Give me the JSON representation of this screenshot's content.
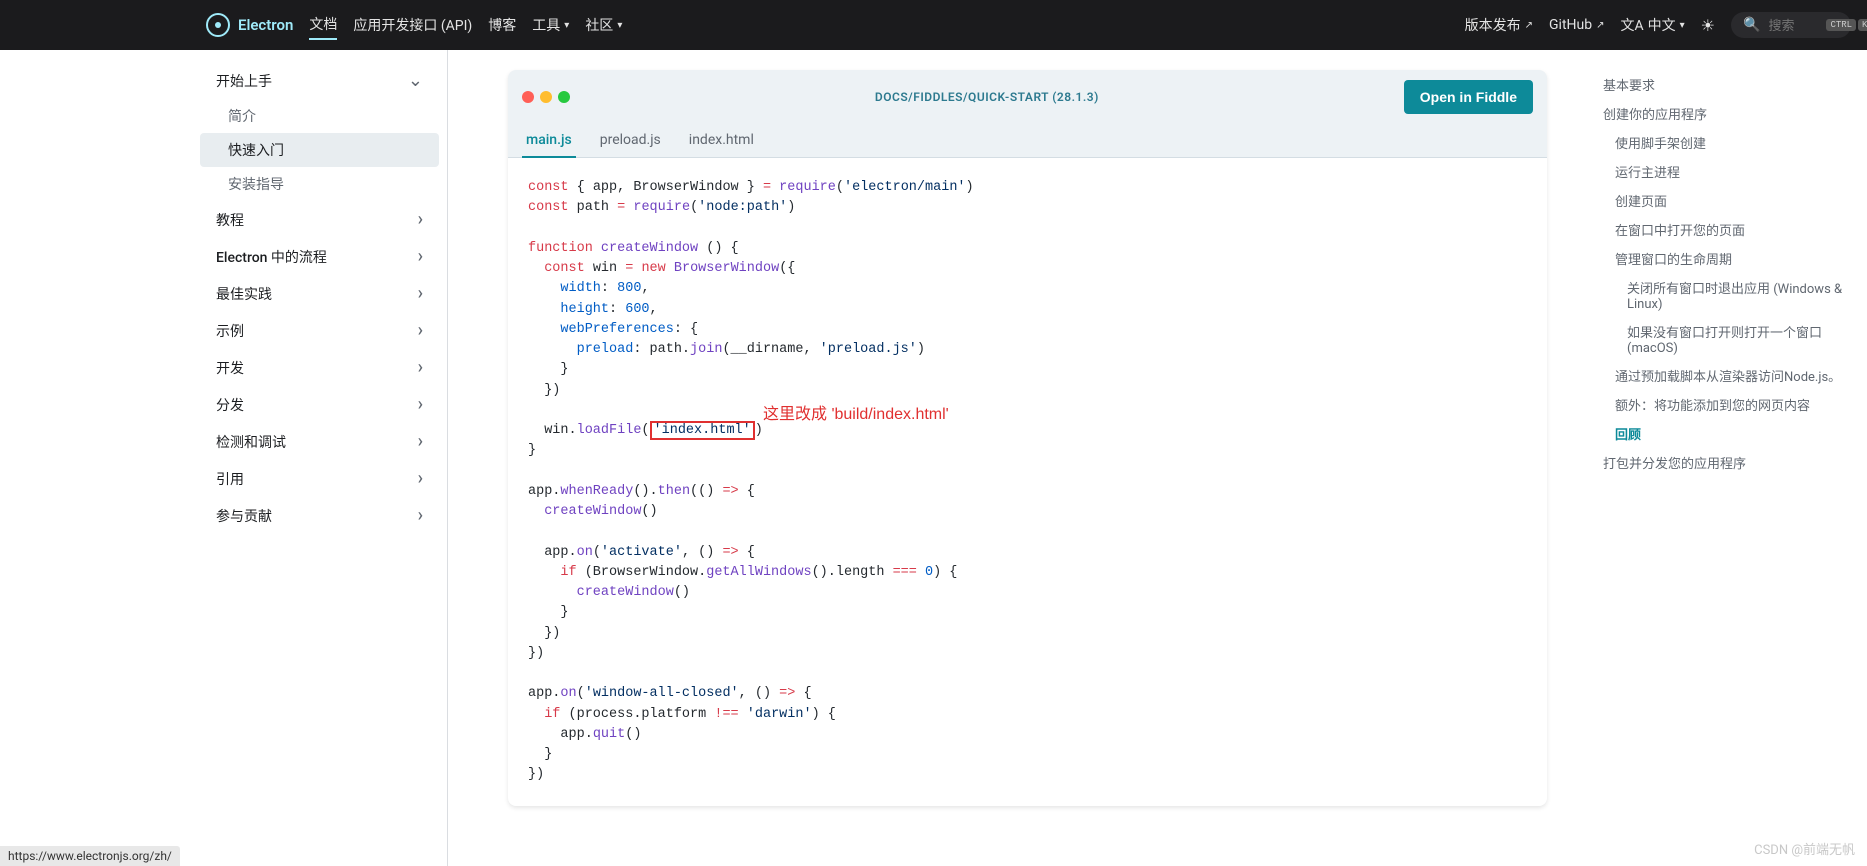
{
  "nav": {
    "brand": "Electron",
    "links": [
      "文档",
      "应用开发接口 (API)",
      "博客",
      "工具",
      "社区"
    ],
    "right_links": [
      "版本发布",
      "GitHub",
      "中文"
    ],
    "lang_prefix": "文A",
    "search_placeholder": "搜索",
    "kbd_keys": [
      "CTRL",
      "K"
    ]
  },
  "sidebar": {
    "categories": [
      {
        "label": "开始上手",
        "expanded": true,
        "items": [
          "简介",
          "快速入门",
          "安装指导"
        ],
        "active": 1
      },
      {
        "label": "教程"
      },
      {
        "label": "Electron 中的流程"
      },
      {
        "label": "最佳实践"
      },
      {
        "label": "示例"
      },
      {
        "label": "开发"
      },
      {
        "label": "分发"
      },
      {
        "label": "检测和调试"
      },
      {
        "label": "引用"
      },
      {
        "label": "参与贡献"
      }
    ]
  },
  "fiddle": {
    "title": "DOCS/FIDDLES/QUICK-START (28.1.3)",
    "open_button": "Open in Fiddle",
    "tabs": [
      "main.js",
      "preload.js",
      "index.html"
    ],
    "active_tab": 0,
    "highlight_text": "'index.html'",
    "annotation": "这里改成 'build/index.html'",
    "code_lines": [
      {
        "t": "const { app, BrowserWindow } = require('electron/main')"
      },
      {
        "t": "const path = require('node:path')"
      },
      {
        "t": ""
      },
      {
        "t": "function createWindow () {"
      },
      {
        "t": "  const win = new BrowserWindow({"
      },
      {
        "t": "    width: 800,"
      },
      {
        "t": "    height: 600,"
      },
      {
        "t": "    webPreferences: {"
      },
      {
        "t": "      preload: path.join(__dirname, 'preload.js')"
      },
      {
        "t": "    }"
      },
      {
        "t": "  })"
      },
      {
        "t": ""
      },
      {
        "t": "  win.loadFile('index.html')"
      },
      {
        "t": "}"
      },
      {
        "t": ""
      },
      {
        "t": "app.whenReady().then(() => {"
      },
      {
        "t": "  createWindow()"
      },
      {
        "t": ""
      },
      {
        "t": "  app.on('activate', () => {"
      },
      {
        "t": "    if (BrowserWindow.getAllWindows().length === 0) {"
      },
      {
        "t": "      createWindow()"
      },
      {
        "t": "    }"
      },
      {
        "t": "  })"
      },
      {
        "t": "})"
      },
      {
        "t": ""
      },
      {
        "t": "app.on('window-all-closed', () => {"
      },
      {
        "t": "  if (process.platform !== 'darwin') {"
      },
      {
        "t": "    app.quit()"
      },
      {
        "t": "  }"
      },
      {
        "t": "})"
      }
    ]
  },
  "toc": {
    "items": [
      {
        "label": "基本要求",
        "level": 0
      },
      {
        "label": "创建你的应用程序",
        "level": 0
      },
      {
        "label": "使用脚手架创建",
        "level": 1
      },
      {
        "label": "运行主进程",
        "level": 1
      },
      {
        "label": "创建页面",
        "level": 1
      },
      {
        "label": "在窗口中打开您的页面",
        "level": 1
      },
      {
        "label": "管理窗口的生命周期",
        "level": 1
      },
      {
        "label": "关闭所有窗口时退出应用 (Windows & Linux)",
        "level": 2
      },
      {
        "label": "如果没有窗口打开则打开一个窗口 (macOS)",
        "level": 2
      },
      {
        "label": "通过预加载脚本从渲染器访问Node.js。",
        "level": 1
      },
      {
        "label": "额外：将功能添加到您的网页内容",
        "level": 1
      },
      {
        "label": "回顾",
        "level": 1,
        "active": true
      },
      {
        "label": "打包并分发您的应用程序",
        "level": 0
      }
    ]
  },
  "status_url": "https://www.electronjs.org/zh/",
  "watermark": "CSDN @前端无帆"
}
